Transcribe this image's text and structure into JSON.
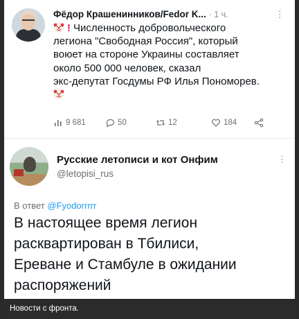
{
  "tweet1": {
    "author": "Фёдор Крашенинников/Fedor K...",
    "time": "· 1 ч.",
    "more": "⋮",
    "lines": [
      "Численность добровольческого",
      "легиона \"Свободная Россия\", который",
      "воюет на стороне Украины составляет",
      "около 500 000 человек, сказал",
      "экс-депутат Госдумы РФ Илья Пономорев."
    ],
    "exclamation": "!",
    "stats": {
      "views": "9 681",
      "replies": "50",
      "retweets": "12",
      "likes": "184"
    }
  },
  "tweet2": {
    "author": "Русские летописи и кот Онфим",
    "handle": "@letopisi_rus",
    "more": "⋮",
    "reply_prefix": "В ответ",
    "reply_to": "@Fyodorrrrr",
    "lines": [
      "В настоящее время легион",
      "расквартирован в Тбилиси,",
      "Ереване и Стамбуле в ожидании",
      "распоряжений"
    ]
  },
  "caption": "Новости с фронта.",
  "colors": {
    "link": "#1d9bf0",
    "exclamation": "#e0245e",
    "muted": "#6b6f73"
  },
  "icons": [
    "clown-emoji-icon",
    "views-chart-icon",
    "reply-icon",
    "retweet-icon",
    "like-icon",
    "share-icon"
  ]
}
